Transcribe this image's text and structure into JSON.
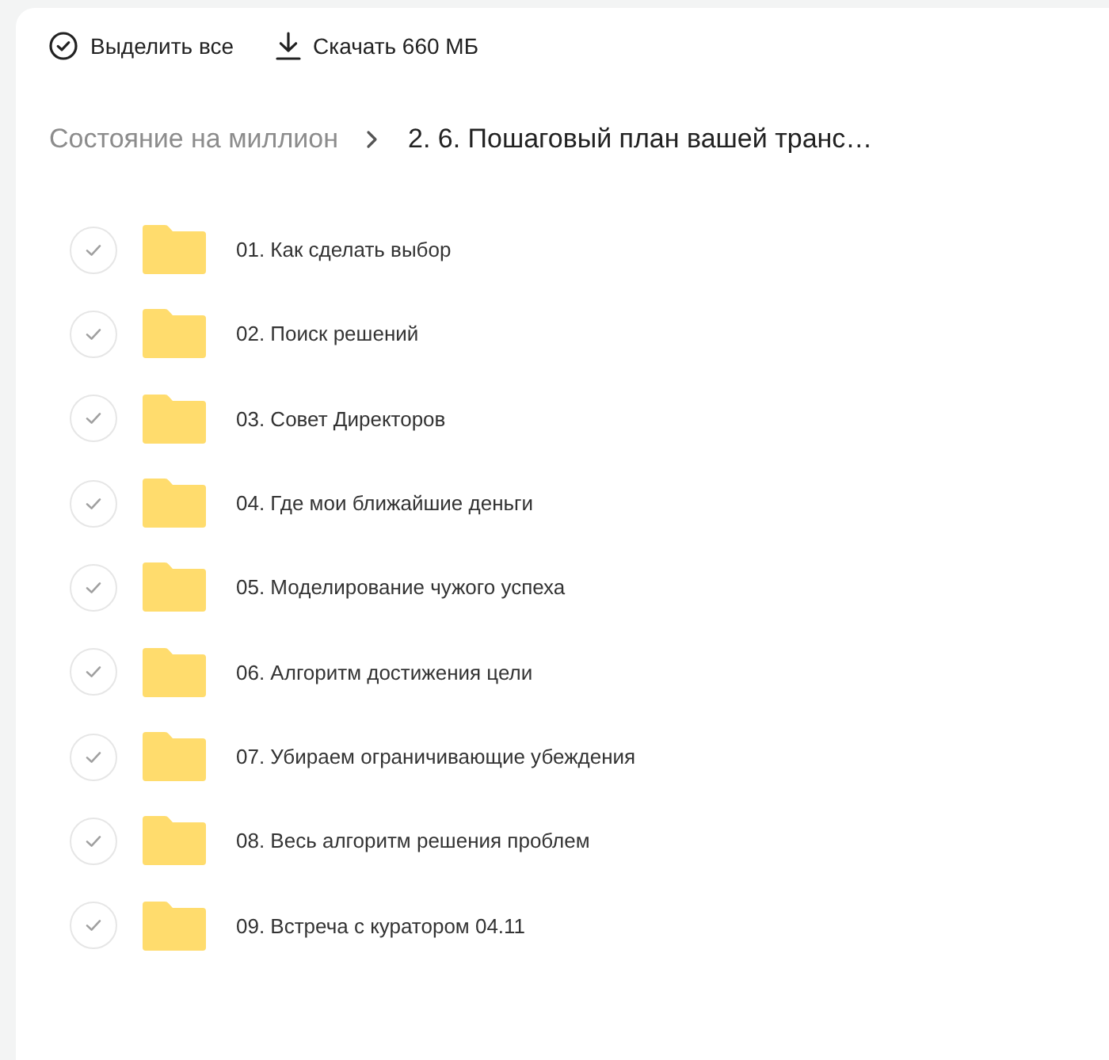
{
  "toolbar": {
    "select_all": {
      "label": "Выделить все"
    },
    "download": {
      "label": "Скачать 660 МБ"
    }
  },
  "breadcrumb": [
    {
      "label": "Состояние на миллион",
      "current": false
    },
    {
      "label": "2. 6. Пошаговый план вашей транс…",
      "current": true
    }
  ],
  "folders": [
    {
      "name": "01. Как сделать выбор",
      "selected": false
    },
    {
      "name": "02. Поиск решений",
      "selected": false
    },
    {
      "name": "03. Совет Директоров",
      "selected": false
    },
    {
      "name": "04. Где мои ближайшие деньги",
      "selected": false
    },
    {
      "name": "05. Моделирование чужого успеха",
      "selected": false
    },
    {
      "name": "06. Алгоритм достижения цели",
      "selected": false
    },
    {
      "name": "07. Убираем ограничивающие убеждения",
      "selected": false
    },
    {
      "name": "08. Весь алгоритм решения проблем",
      "selected": false
    },
    {
      "name": "09. Встреча с куратором 04.11",
      "selected": false
    }
  ]
}
